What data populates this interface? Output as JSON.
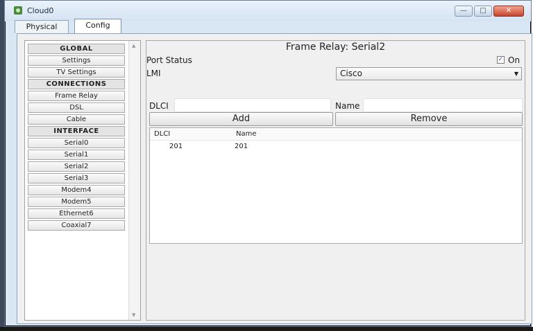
{
  "window": {
    "title": "Cloud0"
  },
  "tabs": [
    {
      "label": "Physical",
      "active": false
    },
    {
      "label": "Config",
      "active": true
    }
  ],
  "sidebar": {
    "items": [
      {
        "label": "GLOBAL",
        "header": true
      },
      {
        "label": "Settings",
        "header": false
      },
      {
        "label": "TV Settings",
        "header": false
      },
      {
        "label": "CONNECTIONS",
        "header": true
      },
      {
        "label": "Frame Relay",
        "header": false
      },
      {
        "label": "DSL",
        "header": false
      },
      {
        "label": "Cable",
        "header": false
      },
      {
        "label": "INTERFACE",
        "header": true
      },
      {
        "label": "Serial0",
        "header": false
      },
      {
        "label": "Serial1",
        "header": false
      },
      {
        "label": "Serial2",
        "header": false
      },
      {
        "label": "Serial3",
        "header": false
      },
      {
        "label": "Modem4",
        "header": false
      },
      {
        "label": "Modem5",
        "header": false
      },
      {
        "label": "Ethernet6",
        "header": false
      },
      {
        "label": "Coaxial7",
        "header": false
      }
    ]
  },
  "panel": {
    "title": "Frame Relay: Serial2",
    "port_status_label": "Port Status",
    "port_on_label": "On",
    "port_on_checked": true,
    "lmi_label": "LMI",
    "lmi_value": "Cisco",
    "dlci_label": "DLCI",
    "dlci_value": "",
    "name_label": "Name",
    "name_value": "",
    "add_label": "Add",
    "remove_label": "Remove",
    "table": {
      "headers": [
        "DLCI",
        "Name"
      ],
      "rows": [
        [
          "201",
          "201"
        ]
      ]
    }
  },
  "colors": {
    "window_bg": "#d9e6f3",
    "close_button": "#c9442c"
  }
}
